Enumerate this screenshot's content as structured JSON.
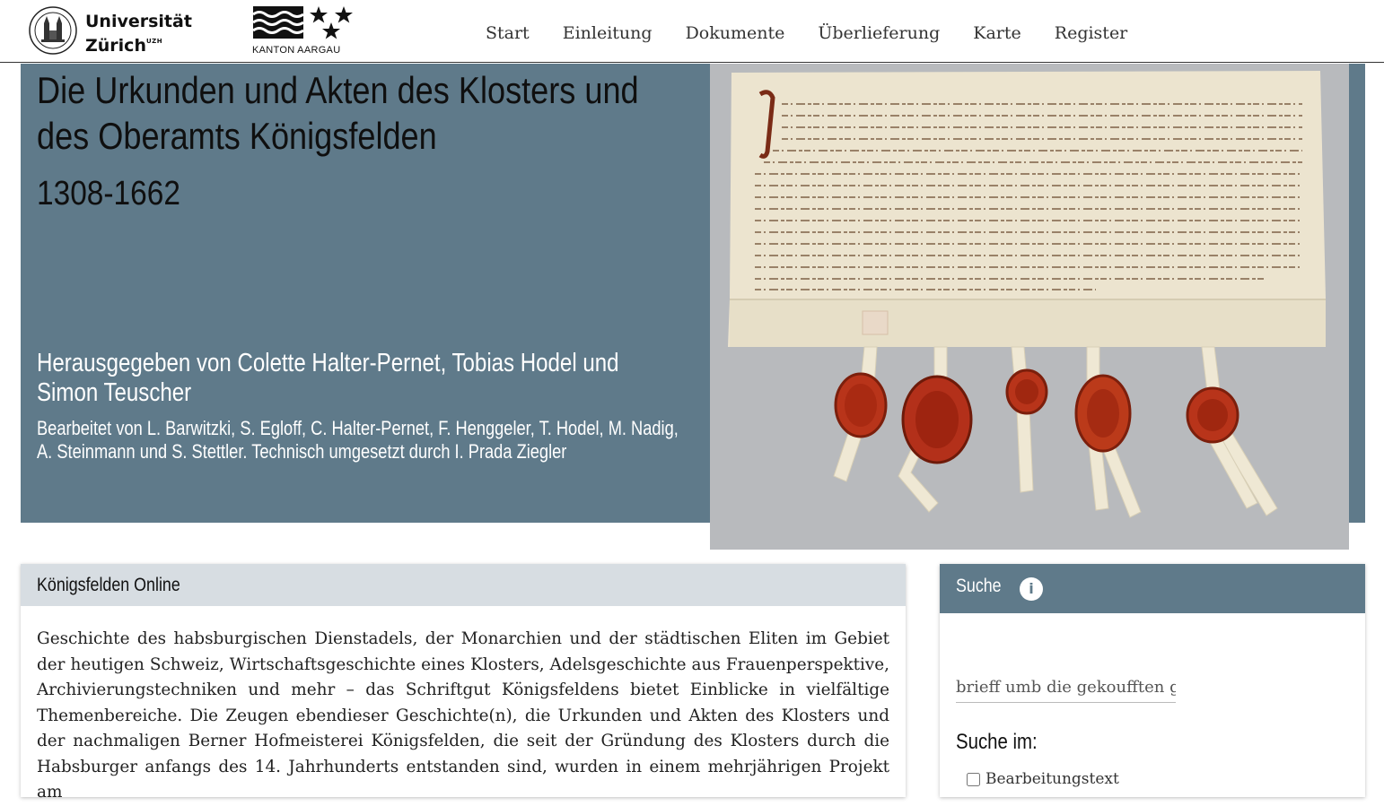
{
  "header": {
    "uzh_line1": "Universität",
    "uzh_line2": "Zürich",
    "uzh_sup": "UZH",
    "aargau_caption": "KANTON AARGAU",
    "nav": [
      "Start",
      "Einleitung",
      "Dokumente",
      "Überlieferung",
      "Karte",
      "Register"
    ]
  },
  "hero": {
    "title": "Die Urkunden und Akten des Klosters und des Oberamts Königsfelden",
    "years": "1308-1662",
    "editors": "Herausgegeben von Colette Halter-Pernet, Tobias Hodel und Simon Teuscher",
    "contributors": "Bearbeitet von L. Barwitzki, S. Egloff, C. Halter-Pernet, F. Henggeler, T. Hodel, M. Nadig, A. Steinmann und S. Stettler. Technisch umgesetzt durch I. Prada Ziegler"
  },
  "intro": {
    "heading": "Königsfelden Online",
    "text": "Geschichte des habsburgischen Dienstadels, der Monarchien und der städtischen Eliten im Gebiet der heutigen Schweiz, Wirtschaftsgeschichte eines Klosters, Adelsgeschichte aus Frauenperspektive, Archivierungstechniken und mehr – das Schriftgut Königsfeldens bietet Einblicke in vielfältige Themenbereiche. Die Zeugen ebendieser Geschichte(n), die Urkunden und Akten des Klosters und der nachmaligen Berner Hofmeisterei Königsfelden, die seit der Gründung des Klosters durch die Habsburger anfangs des 14. Jahrhunderts entstanden sind, wurden in einem mehrjährigen Projekt am"
  },
  "search": {
    "heading": "Suche",
    "input_value": "brieff umb die gekoufften g",
    "search_in_label": "Suche im:",
    "checkbox_label": "Bearbeitungstext"
  },
  "colors": {
    "accent": "#5f7a8a",
    "card_header_light": "#d7dde2"
  }
}
